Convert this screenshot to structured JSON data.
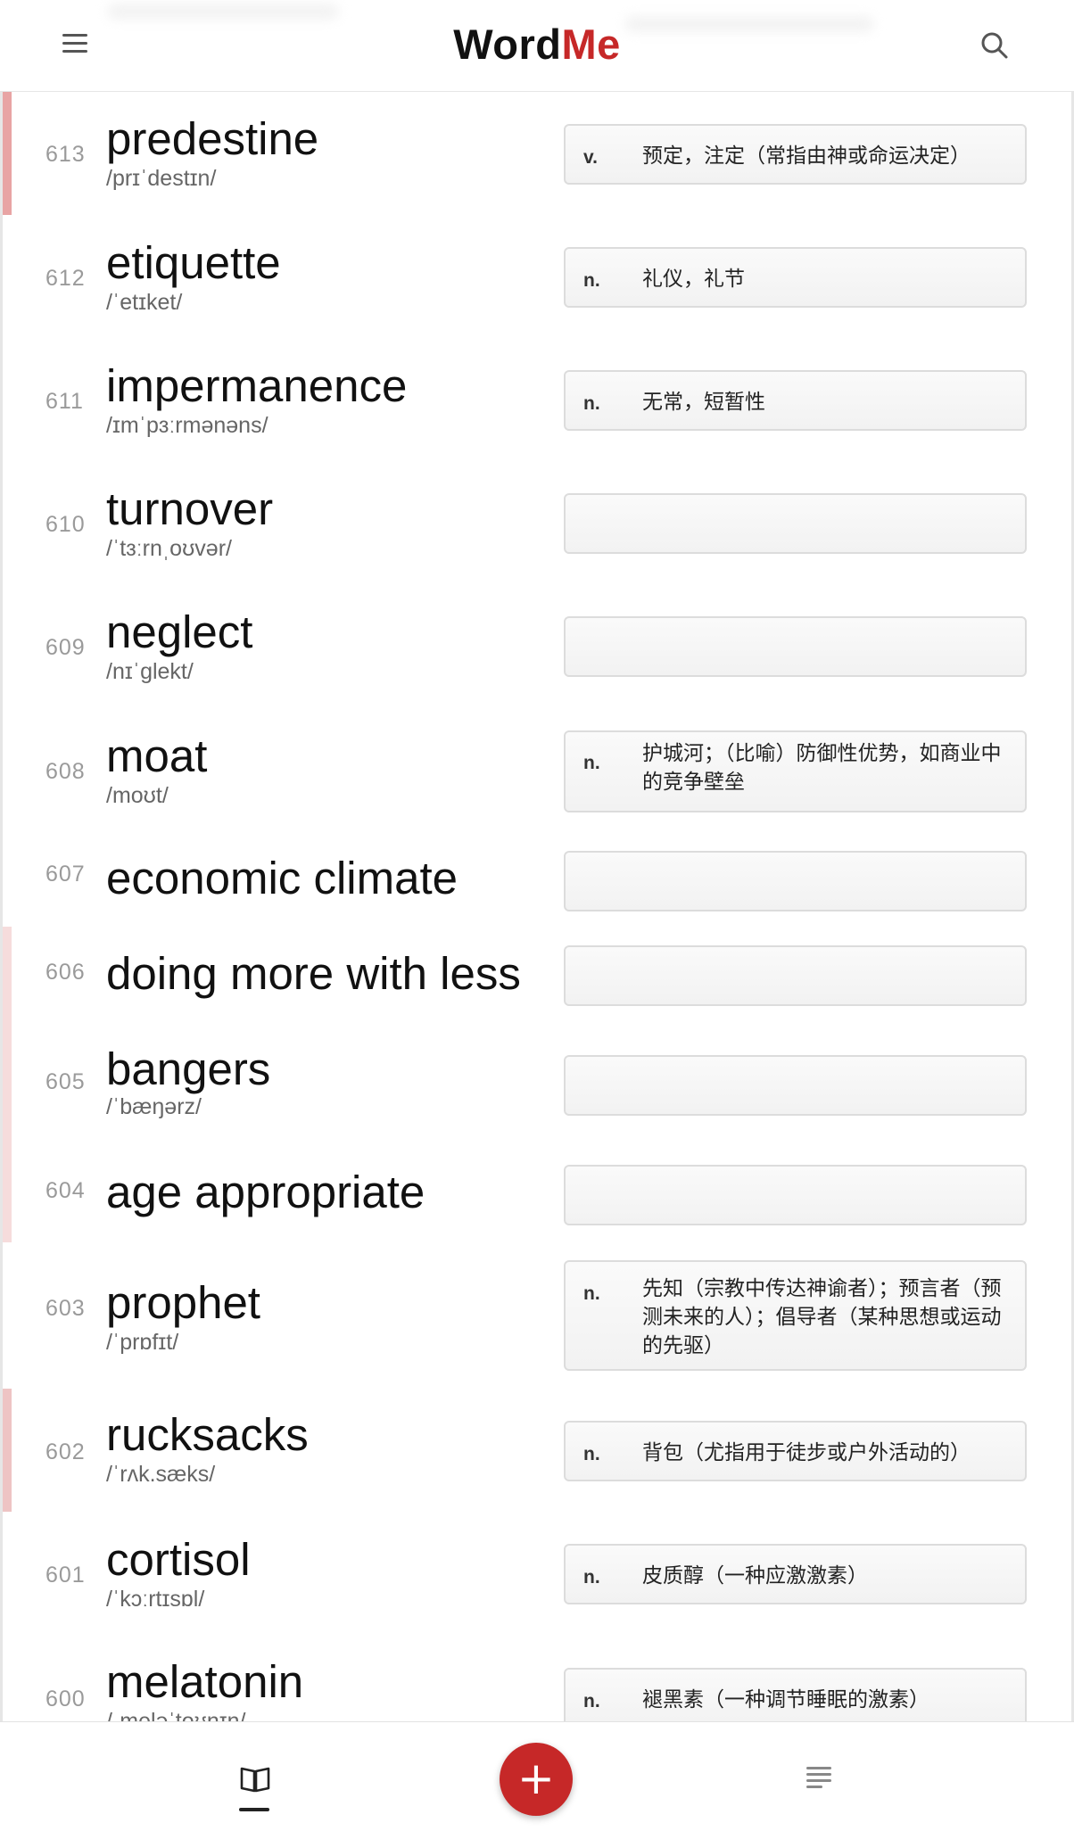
{
  "app": {
    "title_main": "Word",
    "title_accent": "Me",
    "brand_color": "#c62828"
  },
  "header": {
    "menu_icon": "hamburger-menu-icon",
    "search_icon": "search-icon"
  },
  "words": [
    {
      "num": "613",
      "word": "predestine",
      "phonetic": "/prɪˈdestɪn/",
      "pos": "v.",
      "meaning": "预定，注定（常指由神或命运决定）",
      "accent": "#e8a4a4"
    },
    {
      "num": "612",
      "word": "etiquette",
      "phonetic": "/ˈetɪket/",
      "pos": "n.",
      "meaning": "礼仪，礼节",
      "accent": ""
    },
    {
      "num": "611",
      "word": "impermanence",
      "phonetic": "/ɪmˈpɜːrmənəns/",
      "pos": "n.",
      "meaning": "无常，短暂性",
      "accent": ""
    },
    {
      "num": "610",
      "word": "turnover",
      "phonetic": "/ˈtɜːrnˌoʊvər/",
      "pos": "",
      "meaning": "",
      "accent": ""
    },
    {
      "num": "609",
      "word": "neglect",
      "phonetic": "/nɪˈɡlekt/",
      "pos": "",
      "meaning": "",
      "accent": ""
    },
    {
      "num": "608",
      "word": "moat",
      "phonetic": "/moʊt/",
      "pos": "n.",
      "meaning": "护城河；（比喻）防御性优势，如商业中的竞争壁垒",
      "accent": ""
    },
    {
      "num": "607",
      "word": "economic climate",
      "phonetic": "",
      "pos": "",
      "meaning": "",
      "accent": ""
    },
    {
      "num": "606",
      "word": "doing more with less",
      "phonetic": "",
      "pos": "",
      "meaning": "",
      "accent": "#f6dcdc"
    },
    {
      "num": "605",
      "word": "bangers",
      "phonetic": "/ˈbæŋərz/",
      "pos": "",
      "meaning": "",
      "accent": "#f6dcdc"
    },
    {
      "num": "604",
      "word": "age appropriate",
      "phonetic": "",
      "pos": "",
      "meaning": "",
      "accent": "#f6dcdc"
    },
    {
      "num": "603",
      "word": "prophet",
      "phonetic": "/ˈprɒfɪt/",
      "pos": "n.",
      "meaning": "先知（宗教中传达神谕者）；预言者（预测未来的人）；倡导者（某种思想或运动的先驱）",
      "accent": ""
    },
    {
      "num": "602",
      "word": "rucksacks",
      "phonetic": "/ˈrʌk.sæks/",
      "pos": "n.",
      "meaning": "背包（尤指用于徒步或户外活动的）",
      "accent": "#eec4c4"
    },
    {
      "num": "601",
      "word": "cortisol",
      "phonetic": "/ˈkɔːrtɪsɒl/",
      "pos": "n.",
      "meaning": "皮质醇（一种应激激素）",
      "accent": ""
    },
    {
      "num": "600",
      "word": "melatonin",
      "phonetic": "/ˌmeləˈtoʊnɪn/",
      "pos": "n.",
      "meaning": "褪黑素（一种调节睡眠的激素）",
      "accent": ""
    }
  ],
  "bottom_nav": {
    "book_tab_icon": "open-book-icon",
    "add_label": "+",
    "list_tab_icon": "list-lines-icon"
  }
}
